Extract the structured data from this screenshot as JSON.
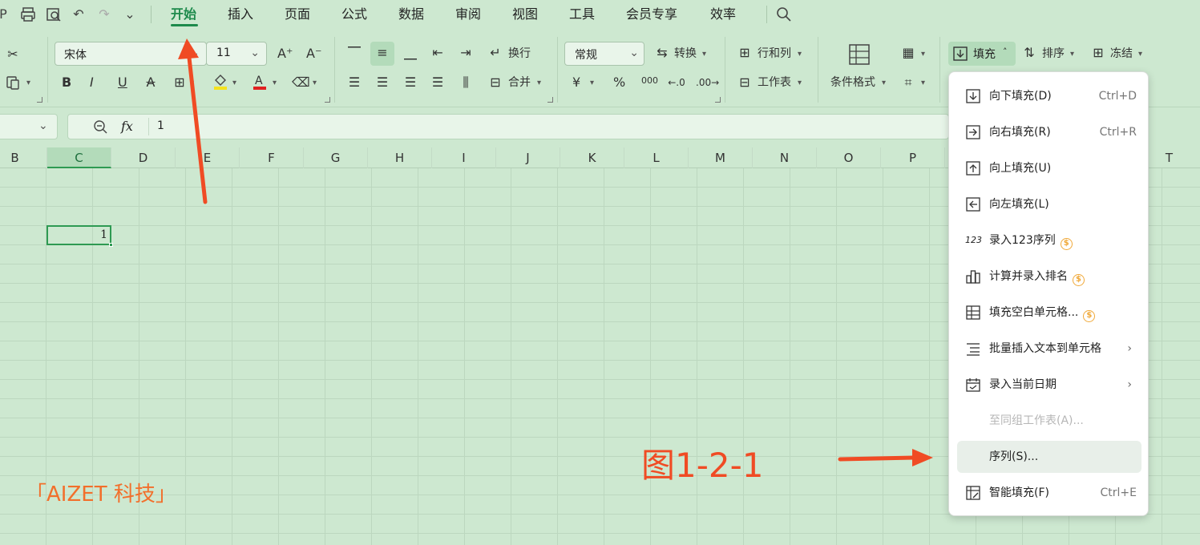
{
  "menu": {
    "tabs": [
      "开始",
      "插入",
      "页面",
      "公式",
      "数据",
      "审阅",
      "视图",
      "工具",
      "会员专享",
      "效率"
    ],
    "active_tab": "开始"
  },
  "ribbon": {
    "font_name": "宋体",
    "font_size": "11",
    "wrap_label": "换行",
    "merge_label": "合并",
    "number_format": "常规",
    "convert_label": "转换",
    "rows_cols_label": "行和列",
    "worksheet_label": "工作表",
    "cond_format_label": "条件格式",
    "fill_label": "填充",
    "sort_label": "排序",
    "freeze_label": "冻结",
    "bold": "B",
    "italic": "I",
    "underline": "U",
    "percent": "%",
    "thousands": "000",
    "currency": "¥",
    "font_increase": "A⁺",
    "font_decrease": "A⁻"
  },
  "formula_bar": {
    "fx": "fx",
    "value": "1"
  },
  "grid": {
    "columns": [
      "B",
      "C",
      "D",
      "E",
      "F",
      "G",
      "H",
      "I",
      "J",
      "K",
      "L",
      "M",
      "N",
      "O",
      "P",
      "T"
    ],
    "selected_column": "C",
    "selected_cell_value": "1"
  },
  "fill_menu": {
    "items": [
      {
        "label": "向下填充(D)",
        "shortcut": "Ctrl+D",
        "icon": "fill-down-icon"
      },
      {
        "label": "向右填充(R)",
        "shortcut": "Ctrl+R",
        "icon": "fill-right-icon"
      },
      {
        "label": "向上填充(U)",
        "icon": "fill-up-icon"
      },
      {
        "label": "向左填充(L)",
        "icon": "fill-left-icon"
      },
      {
        "label": "录入123序列",
        "icon": "series-123-icon",
        "premium": true
      },
      {
        "label": "计算并录入排名",
        "icon": "ranking-icon",
        "premium": true
      },
      {
        "label": "填充空白单元格...",
        "icon": "fill-blank-icon",
        "premium": true
      },
      {
        "label": "批量插入文本到单元格",
        "icon": "insert-text-icon",
        "submenu": true
      },
      {
        "label": "录入当前日期",
        "icon": "calendar-icon",
        "submenu": true
      },
      {
        "label": "至同组工作表(A)...",
        "disabled": true
      },
      {
        "label": "序列(S)...",
        "highlighted": true
      },
      {
        "label": "智能填充(F)",
        "shortcut": "Ctrl+E",
        "icon": "smart-fill-icon"
      }
    ]
  },
  "annotations": {
    "figure_label": "图1-2-1",
    "watermark": "「AIZET 科技」",
    "color": "#f04b24"
  },
  "colors": {
    "background": "#cde8d0",
    "accent": "#1e8a4c",
    "premium": "#f0a93a"
  }
}
